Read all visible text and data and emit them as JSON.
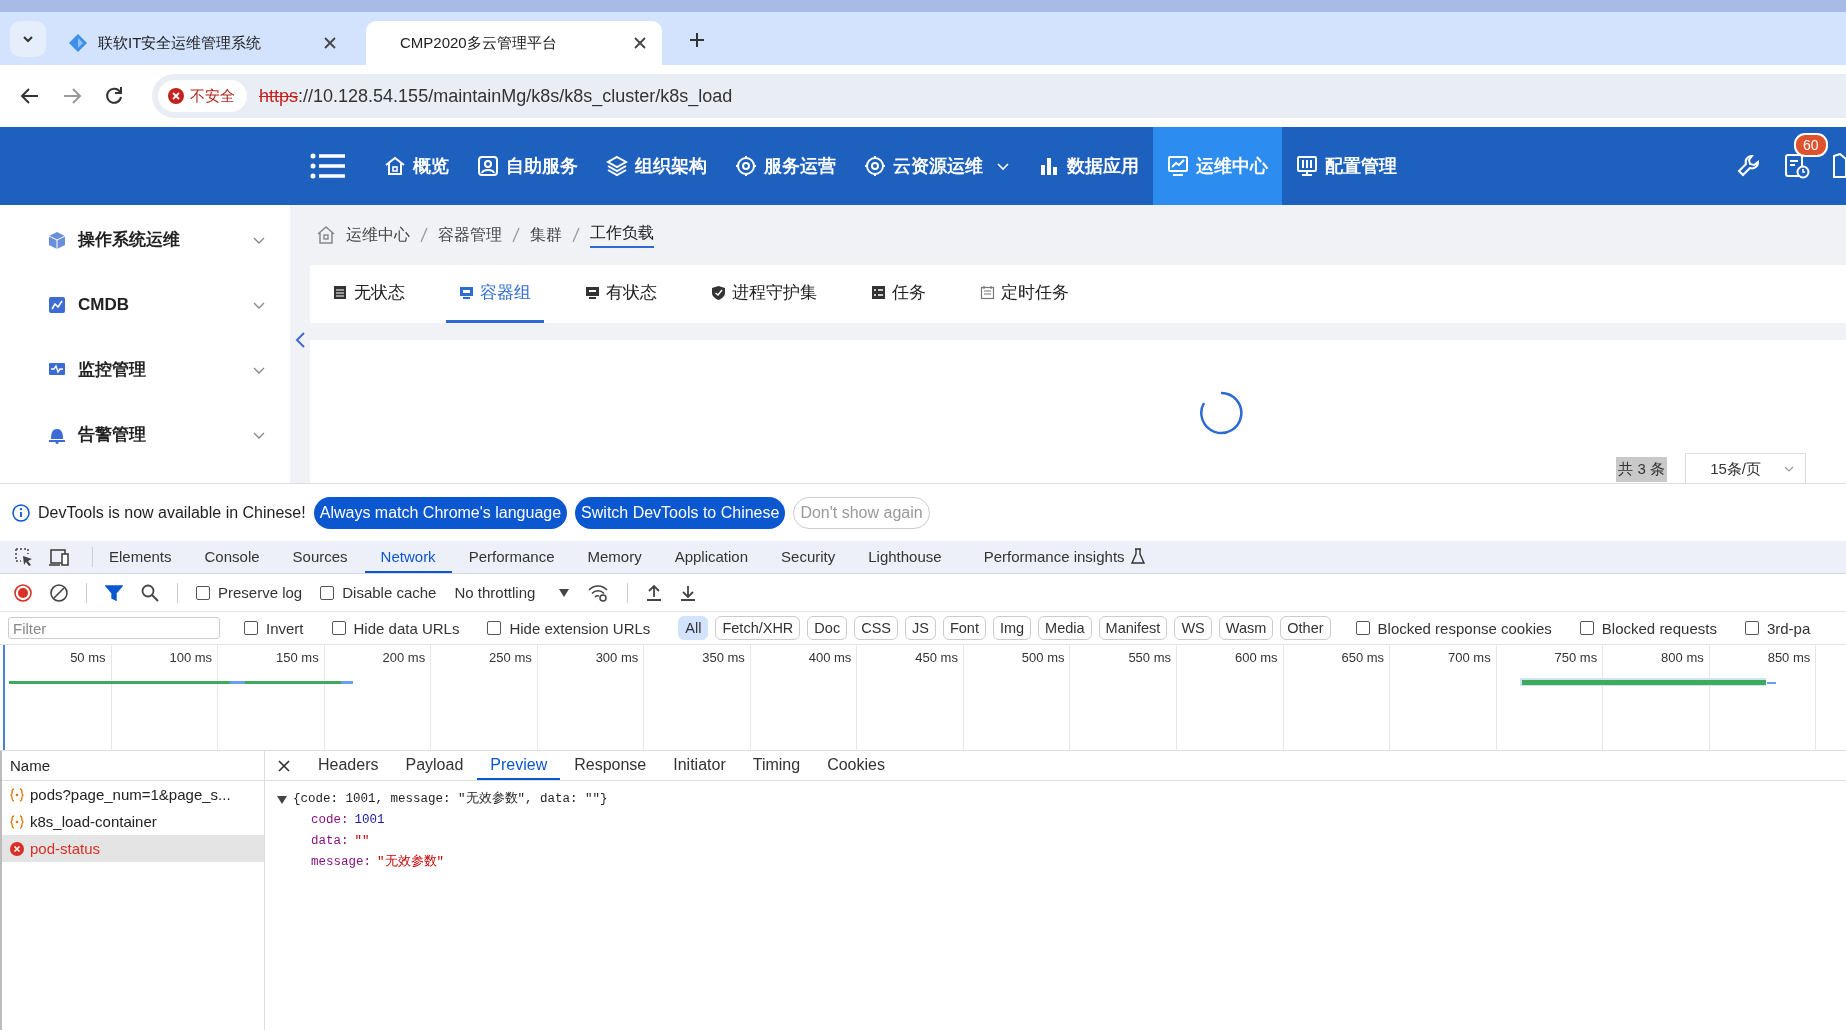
{
  "browser": {
    "tabs": [
      {
        "title": "联软IT安全运维管理系统",
        "selected": false
      },
      {
        "title": "CMP2020多云管理平台",
        "selected": true
      }
    ],
    "address": {
      "security": "不安全",
      "scheme": "https",
      "rest": "://10.128.54.155/maintainMg/k8s/k8s_cluster/k8s_load"
    }
  },
  "nav": {
    "items": [
      {
        "label": "概览",
        "selected": false,
        "dropdown": false
      },
      {
        "label": "自助服务",
        "selected": false,
        "dropdown": false
      },
      {
        "label": "组织架构",
        "selected": false,
        "dropdown": false
      },
      {
        "label": "服务运营",
        "selected": false,
        "dropdown": false
      },
      {
        "label": "云资源运维",
        "selected": false,
        "dropdown": true
      },
      {
        "label": "数据应用",
        "selected": false,
        "dropdown": false
      },
      {
        "label": "运维中心",
        "selected": true,
        "dropdown": false
      },
      {
        "label": "配置管理",
        "selected": false,
        "dropdown": false
      }
    ],
    "badge": "60"
  },
  "sidebar": {
    "items": [
      {
        "label": "操作系统运维",
        "expanded": false
      },
      {
        "label": "CMDB",
        "expanded": false
      },
      {
        "label": "监控管理",
        "expanded": false
      },
      {
        "label": "告警管理",
        "expanded": false
      }
    ]
  },
  "breadcrumb": [
    "运维中心",
    "容器管理",
    "集群",
    "工作负载"
  ],
  "workload_tabs": [
    {
      "label": "无状态",
      "selected": false
    },
    {
      "label": "容器组",
      "selected": true
    },
    {
      "label": "有状态",
      "selected": false
    },
    {
      "label": "进程守护集",
      "selected": false
    },
    {
      "label": "任务",
      "selected": false
    },
    {
      "label": "定时任务",
      "selected": false
    }
  ],
  "pagination": {
    "total": "共 3 条",
    "page_size": "15条/页"
  },
  "devtools": {
    "notice": {
      "text": "DevTools is now available in Chinese!",
      "buttons": [
        "Always match Chrome's language",
        "Switch DevTools to Chinese",
        "Don't show again"
      ]
    },
    "panels": [
      {
        "label": "Elements",
        "selected": false,
        "experimental": false
      },
      {
        "label": "Console",
        "selected": false,
        "experimental": false
      },
      {
        "label": "Sources",
        "selected": false,
        "experimental": false
      },
      {
        "label": "Network",
        "selected": true,
        "experimental": false
      },
      {
        "label": "Performance",
        "selected": false,
        "experimental": false
      },
      {
        "label": "Memory",
        "selected": false,
        "experimental": false
      },
      {
        "label": "Application",
        "selected": false,
        "experimental": false
      },
      {
        "label": "Security",
        "selected": false,
        "experimental": false
      },
      {
        "label": "Lighthouse",
        "selected": false,
        "experimental": false
      },
      {
        "label": "Performance insights",
        "selected": false,
        "experimental": true
      }
    ],
    "toolbar": {
      "recording": true,
      "filter_on": true,
      "checkboxes": [
        {
          "label": "Preserve log",
          "checked": false
        },
        {
          "label": "Disable cache",
          "checked": false
        }
      ],
      "throttling": "No throttling"
    },
    "filter": {
      "placeholder": "Filter",
      "checkboxes": [
        {
          "label": "Invert",
          "checked": false
        },
        {
          "label": "Hide data URLs",
          "checked": false
        },
        {
          "label": "Hide extension URLs",
          "checked": false
        }
      ],
      "types": [
        {
          "label": "All",
          "selected": true
        },
        {
          "label": "Fetch/XHR",
          "selected": false
        },
        {
          "label": "Doc",
          "selected": false
        },
        {
          "label": "CSS",
          "selected": false
        },
        {
          "label": "JS",
          "selected": false
        },
        {
          "label": "Font",
          "selected": false
        },
        {
          "label": "Img",
          "selected": false
        },
        {
          "label": "Media",
          "selected": false
        },
        {
          "label": "Manifest",
          "selected": false
        },
        {
          "label": "WS",
          "selected": false
        },
        {
          "label": "Wasm",
          "selected": false
        },
        {
          "label": "Other",
          "selected": false
        }
      ],
      "more_checkboxes": [
        {
          "label": "Blocked response cookies",
          "checked": false
        },
        {
          "label": "Blocked requests",
          "checked": false
        },
        {
          "label": "3rd-pa",
          "checked": false
        }
      ]
    },
    "timeline_ticks": [
      "50 ms",
      "100 ms",
      "150 ms",
      "200 ms",
      "250 ms",
      "300 ms",
      "350 ms",
      "400 ms",
      "450 ms",
      "500 ms",
      "550 ms",
      "600 ms",
      "650 ms",
      "700 ms",
      "750 ms",
      "800 ms",
      "850 ms"
    ],
    "requests": {
      "column": "Name",
      "rows": [
        {
          "name": "pods?page_num=1&page_s...",
          "kind": "fetch",
          "selected": false
        },
        {
          "name": "k8s_load-container",
          "kind": "fetch",
          "selected": false
        },
        {
          "name": "pod-status",
          "kind": "error",
          "selected": true
        }
      ]
    },
    "detail_tabs": [
      {
        "label": "Headers",
        "selected": false
      },
      {
        "label": "Payload",
        "selected": false
      },
      {
        "label": "Preview",
        "selected": true
      },
      {
        "label": "Response",
        "selected": false
      },
      {
        "label": "Initiator",
        "selected": false
      },
      {
        "label": "Timing",
        "selected": false
      },
      {
        "label": "Cookies",
        "selected": false
      }
    ],
    "preview": {
      "expanded": true,
      "summary": "{code: 1001, message: \"无效参数\", data: \"\"}",
      "fields": [
        {
          "key": "code:",
          "value": "1001",
          "kind": "number"
        },
        {
          "key": "data:",
          "value": "\"\"",
          "kind": "string"
        },
        {
          "key": "message:",
          "value": "\"无效参数\"",
          "kind": "string"
        }
      ]
    }
  }
}
